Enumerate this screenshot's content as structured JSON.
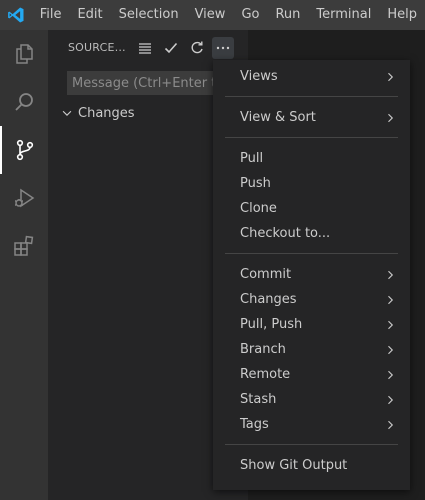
{
  "menubar": {
    "items": [
      "File",
      "Edit",
      "Selection",
      "View",
      "Go",
      "Run",
      "Terminal",
      "Help"
    ]
  },
  "activitybar": {
    "items": [
      {
        "icon": "files-icon",
        "active": false
      },
      {
        "icon": "search-icon",
        "active": false
      },
      {
        "icon": "source-control-icon",
        "active": true
      },
      {
        "icon": "run-debug-icon",
        "active": false
      },
      {
        "icon": "extensions-icon",
        "active": false
      }
    ]
  },
  "sidebar": {
    "title": "SOURCE CONTROL",
    "actions": [
      "view-as-list-icon",
      "commit-check-icon",
      "refresh-icon",
      "more-actions-icon"
    ],
    "message_placeholder": "Message (Ctrl+Enter to commit)",
    "message_value": "",
    "changes_label": "Changes"
  },
  "context_menu": {
    "groups": [
      [
        {
          "label": "Views",
          "submenu": true
        }
      ],
      [
        {
          "label": "View & Sort",
          "submenu": true
        }
      ],
      [
        {
          "label": "Pull",
          "submenu": false
        },
        {
          "label": "Push",
          "submenu": false
        },
        {
          "label": "Clone",
          "submenu": false
        },
        {
          "label": "Checkout to...",
          "submenu": false
        }
      ],
      [
        {
          "label": "Commit",
          "submenu": true
        },
        {
          "label": "Changes",
          "submenu": true
        },
        {
          "label": "Pull, Push",
          "submenu": true
        },
        {
          "label": "Branch",
          "submenu": true
        },
        {
          "label": "Remote",
          "submenu": true
        },
        {
          "label": "Stash",
          "submenu": true
        },
        {
          "label": "Tags",
          "submenu": true
        }
      ],
      [
        {
          "label": "Show Git Output",
          "submenu": false
        }
      ]
    ]
  },
  "colors": {
    "titlebar": "#3c3c3c",
    "activitybar": "#333333",
    "sidebar": "#252526",
    "editor": "#1e1e1e",
    "menu": "#252526",
    "logo_blue": "#23a9f2"
  }
}
